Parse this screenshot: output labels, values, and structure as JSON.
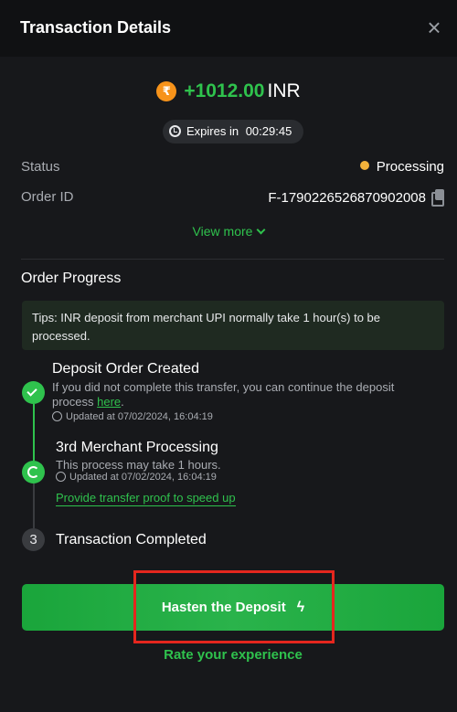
{
  "header": {
    "title": "Transaction Details",
    "close_icon": "close-icon"
  },
  "amount": {
    "coin_symbol": "₹",
    "value": "+1012.00",
    "currency": "INR"
  },
  "expiry": {
    "label": "Expires in",
    "time": "00:29:45"
  },
  "details": {
    "status_label": "Status",
    "status_value": "Processing",
    "status_color": "#f3b23b",
    "order_id_label": "Order ID",
    "order_id_value": "F-1790226526870902008"
  },
  "view_more": "View more",
  "progress": {
    "title": "Order Progress",
    "tips": "Tips: INR deposit from merchant UPI normally take 1 hour(s) to be processed.",
    "steps": [
      {
        "title": "Deposit Order Created",
        "desc_prefix": "If you did not complete this transfer, you can continue the deposit process ",
        "desc_link": "here",
        "desc_suffix": ".",
        "time": "Updated at 07/02/2024, 16:04:19"
      },
      {
        "title": "3rd Merchant Processing",
        "desc": "This process may take 1 hours.",
        "time": "Updated at 07/02/2024, 16:04:19",
        "link": "Provide transfer proof to speed up"
      },
      {
        "number": "3",
        "title": "Transaction Completed"
      }
    ]
  },
  "cta": {
    "label": "Hasten the Deposit",
    "icon": "bolt-icon"
  },
  "rate": "Rate your experience",
  "colors": {
    "accent": "#2fc24d",
    "background": "#17181b",
    "highlight": "#e5261e"
  }
}
